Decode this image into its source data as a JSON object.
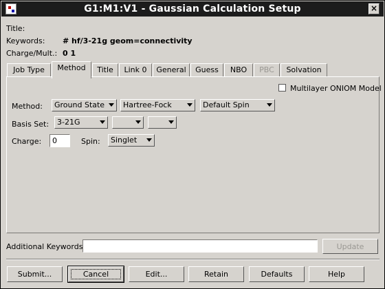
{
  "window": {
    "title": "G1:M1:V1 - Gaussian Calculation Setup",
    "close_label": "×"
  },
  "info": {
    "title_label": "Title:",
    "title_value": "",
    "keywords_label": "Keywords:",
    "keywords_value": "# hf/3-21g geom=connectivity",
    "charge_mult_label": "Charge/Mult.:",
    "charge_mult_value": "0 1"
  },
  "tabs": [
    {
      "label": "Job Type"
    },
    {
      "label": "Method"
    },
    {
      "label": "Title"
    },
    {
      "label": "Link 0"
    },
    {
      "label": "General"
    },
    {
      "label": "Guess"
    },
    {
      "label": "NBO"
    },
    {
      "label": "PBC"
    },
    {
      "label": "Solvation"
    }
  ],
  "method_panel": {
    "oniom_label": "Multilayer ONIOM Model",
    "oniom_checked": false,
    "method_label": "Method:",
    "method_type": "Ground State",
    "method_name": "Hartree-Fock",
    "spin_mode": "Default Spin",
    "basis_label": "Basis Set:",
    "basis_value": "3-21G",
    "basis_opt1": "",
    "basis_opt2": "",
    "charge_label": "Charge:",
    "charge_value": "0",
    "spin_label": "Spin:",
    "spin_value": "Singlet"
  },
  "additional": {
    "label": "Additional Keywords:",
    "value": "",
    "update_label": "Update"
  },
  "buttons": {
    "submit": "Submit...",
    "cancel": "Cancel",
    "edit": "Edit...",
    "retain": "Retain",
    "defaults": "Defaults",
    "help": "Help"
  }
}
